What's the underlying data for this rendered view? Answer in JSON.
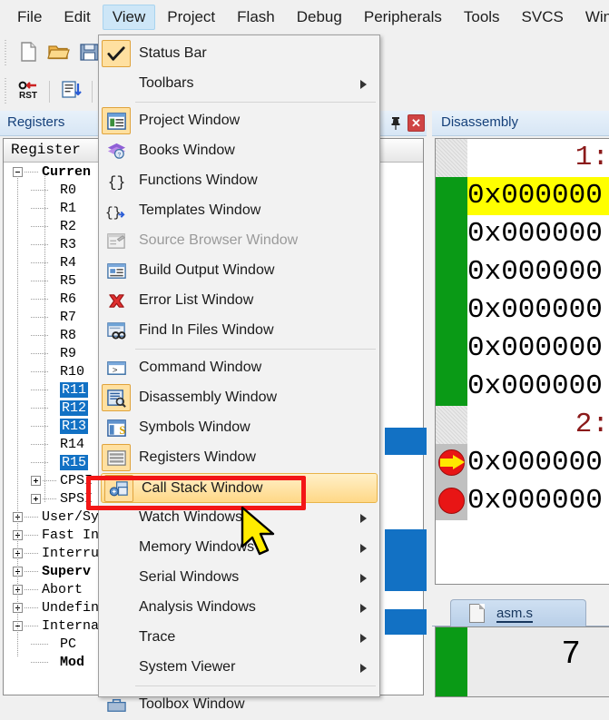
{
  "app": {
    "menubar": [
      {
        "label": "File",
        "active": false
      },
      {
        "label": "Edit",
        "active": false
      },
      {
        "label": "View",
        "active": true
      },
      {
        "label": "Project",
        "active": false
      },
      {
        "label": "Flash",
        "active": false
      },
      {
        "label": "Debug",
        "active": false
      },
      {
        "label": "Peripherals",
        "active": false
      },
      {
        "label": "Tools",
        "active": false
      },
      {
        "label": "SVCS",
        "active": false
      },
      {
        "label": "Windo",
        "active": false
      }
    ]
  },
  "toolbar_row1": {
    "icons": [
      {
        "name": "new-file-icon"
      },
      {
        "name": "open-folder-icon"
      },
      {
        "name": "save-icon"
      },
      {
        "name": "run-to-cursor-icon"
      },
      {
        "name": "insert-bookmark-icon"
      },
      {
        "name": "prev-bookmark-icon"
      },
      {
        "name": "next-bookmark-icon"
      },
      {
        "name": "clear-bookmarks-icon"
      },
      {
        "name": "indent-icon"
      },
      {
        "name": "outdent-icon"
      }
    ]
  },
  "toolbar_row2": {
    "icons": [
      {
        "name": "reset-icon",
        "label": "RST"
      },
      {
        "name": "step-into-icon"
      },
      {
        "name": "symbols-window-icon",
        "active": false
      },
      {
        "name": "registers-window-icon",
        "active": true
      },
      {
        "name": "call-stack-window-icon",
        "active": true
      },
      {
        "name": "watch-window-icon",
        "active": false
      },
      {
        "name": "memory-window-icon",
        "active": true
      },
      {
        "name": "serial-window-icon",
        "active": false
      }
    ]
  },
  "registers_panel": {
    "title": "Registers",
    "pin_icon": "pin-icon",
    "close_icon": "close-icon",
    "column_header": "Register",
    "tree": [
      {
        "label": "Curren",
        "depth": 0,
        "expander": "minus",
        "bold": true,
        "selected": false
      },
      {
        "label": "R0",
        "depth": 2,
        "expander": "",
        "bold": false,
        "selected": false
      },
      {
        "label": "R1",
        "depth": 2,
        "expander": "",
        "bold": false,
        "selected": false
      },
      {
        "label": "R2",
        "depth": 2,
        "expander": "",
        "bold": false,
        "selected": false
      },
      {
        "label": "R3",
        "depth": 2,
        "expander": "",
        "bold": false,
        "selected": false
      },
      {
        "label": "R4",
        "depth": 2,
        "expander": "",
        "bold": false,
        "selected": false
      },
      {
        "label": "R5",
        "depth": 2,
        "expander": "",
        "bold": false,
        "selected": false
      },
      {
        "label": "R6",
        "depth": 2,
        "expander": "",
        "bold": false,
        "selected": false
      },
      {
        "label": "R7",
        "depth": 2,
        "expander": "",
        "bold": false,
        "selected": false
      },
      {
        "label": "R8",
        "depth": 2,
        "expander": "",
        "bold": false,
        "selected": false
      },
      {
        "label": "R9",
        "depth": 2,
        "expander": "",
        "bold": false,
        "selected": false
      },
      {
        "label": "R10",
        "depth": 2,
        "expander": "",
        "bold": false,
        "selected": false
      },
      {
        "label": "R11",
        "depth": 2,
        "expander": "",
        "bold": false,
        "selected": true
      },
      {
        "label": "R12",
        "depth": 2,
        "expander": "",
        "bold": false,
        "selected": true
      },
      {
        "label": "R13",
        "depth": 2,
        "expander": "",
        "bold": false,
        "selected": true
      },
      {
        "label": "R14",
        "depth": 2,
        "expander": "",
        "bold": false,
        "selected": false
      },
      {
        "label": "R15",
        "depth": 2,
        "expander": "",
        "bold": false,
        "selected": true
      },
      {
        "label": "CPSI",
        "depth": 1,
        "expander": "plus",
        "bold": false,
        "selected": false
      },
      {
        "label": "SPSI",
        "depth": 1,
        "expander": "plus",
        "bold": false,
        "selected": false
      },
      {
        "label": "User/Sy",
        "depth": 0,
        "expander": "plus",
        "bold": false,
        "selected": false
      },
      {
        "label": "Fast In",
        "depth": 0,
        "expander": "plus",
        "bold": false,
        "selected": false
      },
      {
        "label": "Interru",
        "depth": 0,
        "expander": "plus",
        "bold": false,
        "selected": false
      },
      {
        "label": "Superv",
        "depth": 0,
        "expander": "plus",
        "bold": true,
        "selected": false
      },
      {
        "label": "Abort",
        "depth": 0,
        "expander": "plus",
        "bold": false,
        "selected": false
      },
      {
        "label": "Undefin",
        "depth": 0,
        "expander": "plus",
        "bold": false,
        "selected": false
      },
      {
        "label": "Interna",
        "depth": 0,
        "expander": "minus",
        "bold": false,
        "selected": false
      },
      {
        "label": "PC",
        "depth": 2,
        "expander": "",
        "bold": false,
        "selected": false
      },
      {
        "label": "Mod",
        "depth": 2,
        "expander": "",
        "bold": true,
        "selected": false
      }
    ]
  },
  "disassembly_panel": {
    "title": "Disassembly",
    "lines": [
      {
        "type": "source",
        "text": "1:",
        "gutter": "hatch"
      },
      {
        "type": "code",
        "text": "0x000000",
        "gutter": "green",
        "highlight": true,
        "marker": ""
      },
      {
        "type": "code",
        "text": "0x000000",
        "gutter": "green",
        "highlight": false,
        "marker": ""
      },
      {
        "type": "code",
        "text": "0x000000",
        "gutter": "green",
        "highlight": false,
        "marker": ""
      },
      {
        "type": "code",
        "text": "0x000000",
        "gutter": "green",
        "highlight": false,
        "marker": ""
      },
      {
        "type": "code",
        "text": "0x000000",
        "gutter": "green",
        "highlight": false,
        "marker": ""
      },
      {
        "type": "code",
        "text": "0x000000",
        "gutter": "green",
        "highlight": false,
        "marker": ""
      },
      {
        "type": "source",
        "text": "2:",
        "gutter": "hatch"
      },
      {
        "type": "code",
        "text": "0x000000",
        "gutter": "gray",
        "highlight": false,
        "marker": "current-statement-arrow"
      },
      {
        "type": "code",
        "text": "0x000000",
        "gutter": "gray",
        "highlight": false,
        "marker": "breakpoint-dot"
      }
    ]
  },
  "editor_panel": {
    "tab_label": "asm.s",
    "tab_icon": "document-icon",
    "line_number": "7"
  },
  "view_menu": {
    "items": [
      {
        "label": "Status Bar",
        "icon": "checkmark-icon",
        "icon_boxed": true,
        "submenu": false,
        "disabled": false,
        "hover": false,
        "sep_after": false
      },
      {
        "label": "Toolbars",
        "icon": "",
        "icon_boxed": false,
        "submenu": true,
        "disabled": false,
        "hover": false,
        "sep_after": true
      },
      {
        "label": "Project Window",
        "icon": "project-window-icon",
        "icon_boxed": true,
        "submenu": false,
        "disabled": false,
        "hover": false,
        "sep_after": false
      },
      {
        "label": "Books Window",
        "icon": "books-window-icon",
        "icon_boxed": false,
        "submenu": false,
        "disabled": false,
        "hover": false,
        "sep_after": false
      },
      {
        "label": "Functions Window",
        "icon": "braces-icon",
        "icon_boxed": false,
        "submenu": false,
        "disabled": false,
        "hover": false,
        "sep_after": false
      },
      {
        "label": "Templates Window",
        "icon": "templates-icon",
        "icon_boxed": false,
        "submenu": false,
        "disabled": false,
        "hover": false,
        "sep_after": false
      },
      {
        "label": "Source Browser Window",
        "icon": "source-browser-icon",
        "icon_boxed": false,
        "submenu": false,
        "disabled": true,
        "hover": false,
        "sep_after": false
      },
      {
        "label": "Build Output Window",
        "icon": "build-output-icon",
        "icon_boxed": false,
        "submenu": false,
        "disabled": false,
        "hover": false,
        "sep_after": false
      },
      {
        "label": "Error List Window",
        "icon": "error-list-icon",
        "icon_boxed": false,
        "submenu": false,
        "disabled": false,
        "hover": false,
        "sep_after": false
      },
      {
        "label": "Find In Files Window",
        "icon": "find-in-files-icon",
        "icon_boxed": false,
        "submenu": false,
        "disabled": false,
        "hover": false,
        "sep_after": true
      },
      {
        "label": "Command Window",
        "icon": "command-window-icon",
        "icon_boxed": false,
        "submenu": false,
        "disabled": false,
        "hover": false,
        "sep_after": false
      },
      {
        "label": "Disassembly Window",
        "icon": "disassembly-window-icon",
        "icon_boxed": true,
        "submenu": false,
        "disabled": false,
        "hover": false,
        "sep_after": false
      },
      {
        "label": "Symbols Window",
        "icon": "symbols-window-icon",
        "icon_boxed": false,
        "submenu": false,
        "disabled": false,
        "hover": false,
        "sep_after": false
      },
      {
        "label": "Registers Window",
        "icon": "registers-window-icon",
        "icon_boxed": true,
        "submenu": false,
        "disabled": false,
        "hover": false,
        "sep_after": false
      },
      {
        "label": "Call Stack Window",
        "icon": "call-stack-window-icon",
        "icon_boxed": true,
        "submenu": false,
        "disabled": false,
        "hover": true,
        "sep_after": false
      },
      {
        "label": "Watch Windows",
        "icon": "",
        "icon_boxed": false,
        "submenu": true,
        "disabled": false,
        "hover": false,
        "sep_after": false
      },
      {
        "label": "Memory Windows",
        "icon": "",
        "icon_boxed": false,
        "submenu": true,
        "disabled": false,
        "hover": false,
        "sep_after": false
      },
      {
        "label": "Serial Windows",
        "icon": "",
        "icon_boxed": false,
        "submenu": true,
        "disabled": false,
        "hover": false,
        "sep_after": false
      },
      {
        "label": "Analysis Windows",
        "icon": "",
        "icon_boxed": false,
        "submenu": true,
        "disabled": false,
        "hover": false,
        "sep_after": false
      },
      {
        "label": "Trace",
        "icon": "",
        "icon_boxed": false,
        "submenu": true,
        "disabled": false,
        "hover": false,
        "sep_after": false
      },
      {
        "label": "System Viewer",
        "icon": "",
        "icon_boxed": false,
        "submenu": true,
        "disabled": false,
        "hover": false,
        "sep_after": true
      },
      {
        "label": "Toolbox Window",
        "icon": "toolbox-icon",
        "icon_boxed": false,
        "submenu": false,
        "disabled": false,
        "hover": false,
        "sep_after": false
      }
    ]
  },
  "annotation": {
    "highlight_color": "#f31616",
    "target_label": "Call Stack Window",
    "cursor_icon": "mouse-pointer-icon"
  },
  "colors": {
    "menu_active_bg": "#cde6f7",
    "selection_blue": "#1271c4",
    "gutter_green": "#0a9a16",
    "highlight_yellow": "#ffff00",
    "breakpoint_red": "#e81515",
    "source_line_red": "#8b1a1a",
    "hover_orange": "#ffd887"
  }
}
